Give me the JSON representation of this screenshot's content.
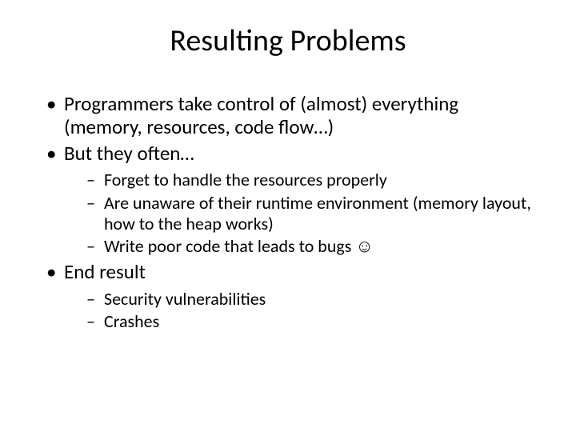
{
  "title": "Resulting Problems",
  "bullets": {
    "b1": "Programmers take control of (almost) everything (memory, resources, code flow…)",
    "b2": "But they often…",
    "b2_sub": {
      "s1": "Forget to handle the resources properly",
      "s2": "Are unaware of their runtime environment (memory layout, how to the heap works)",
      "s3": "Write poor code that leads to bugs ☺"
    },
    "b3": "End result",
    "b3_sub": {
      "s1": "Security vulnerabilities",
      "s2": "Crashes"
    }
  }
}
